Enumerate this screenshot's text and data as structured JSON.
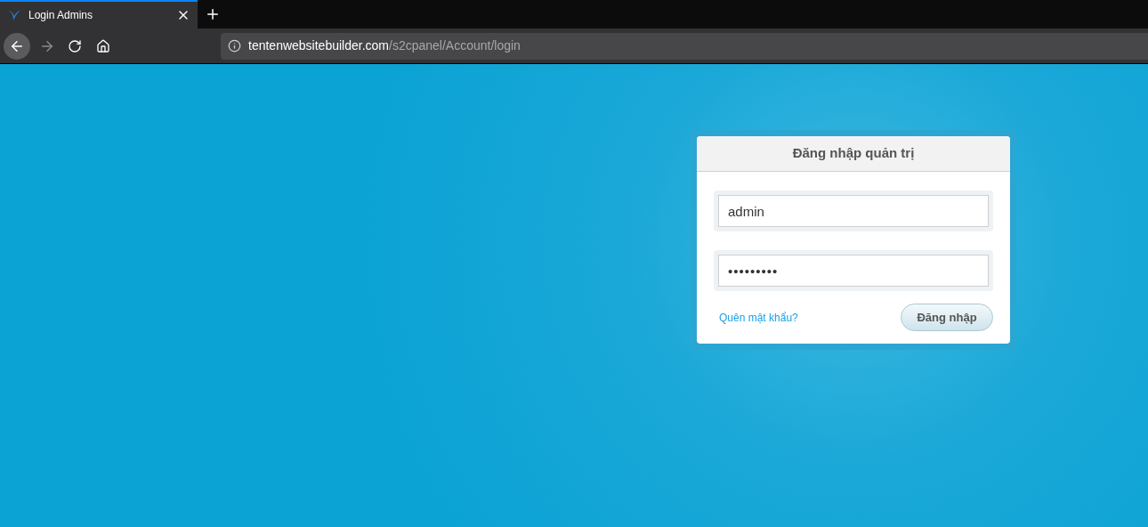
{
  "browser": {
    "tab": {
      "title": "Login Admins",
      "selected": true
    },
    "address": {
      "host": "tentenwebsitebuilder.com",
      "path": "/s2cpanel/Account/login"
    }
  },
  "login": {
    "title": "Đăng nhập quản trị",
    "username": {
      "value": "admin"
    },
    "password": {
      "value": "•••••••••"
    },
    "forgot_link": "Quên mật khẩu?",
    "submit": "Đăng nhập"
  }
}
